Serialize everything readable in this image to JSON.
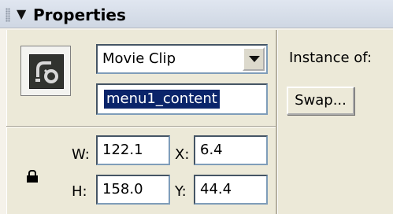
{
  "panel": {
    "title": "Properties"
  },
  "symbol": {
    "type_label": "Movie Clip",
    "instance_name": "menu1_content"
  },
  "instance": {
    "label": "Instance of:",
    "swap_label": "Swap..."
  },
  "dimensions": {
    "w_label": "W:",
    "w_value": "122.1",
    "h_label": "H:",
    "h_value": "158.0",
    "x_label": "X:",
    "x_value": "6.4",
    "y_label": "Y:",
    "y_value": "44.4"
  },
  "icons": {
    "grip": "panel-grip-icon",
    "collapse": "triangle-down-icon",
    "symbol": "movie-clip-symbol-icon",
    "lock": "lock-icon"
  }
}
